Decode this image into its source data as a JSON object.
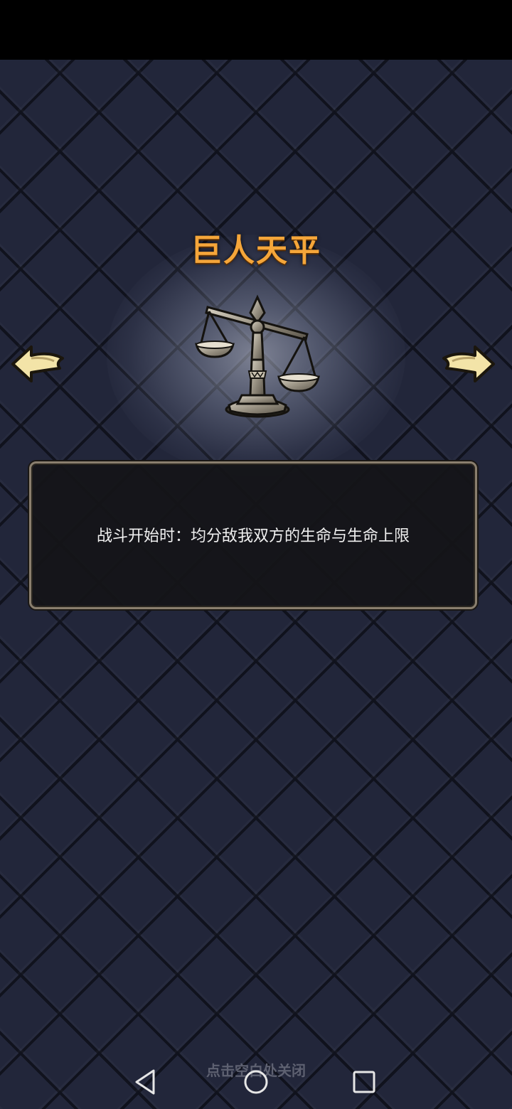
{
  "relic": {
    "title": "巨人天平",
    "icon": "balance-scale-icon",
    "description": "战斗开始时：均分敌我双方的生命与生命上限"
  },
  "navigation": {
    "prev_icon": "arrow-left-icon",
    "next_icon": "arrow-right-icon"
  },
  "hint": {
    "close_text": "点击空白处关闭"
  },
  "system_nav": {
    "back_icon": "back-triangle-icon",
    "home_icon": "home-circle-icon",
    "recent_icon": "recent-square-icon"
  },
  "colors": {
    "title": "#f5a63a",
    "background": "#22263a",
    "panel_border": "#8a7f6e",
    "arrow_fill": "#f3e4a8"
  }
}
